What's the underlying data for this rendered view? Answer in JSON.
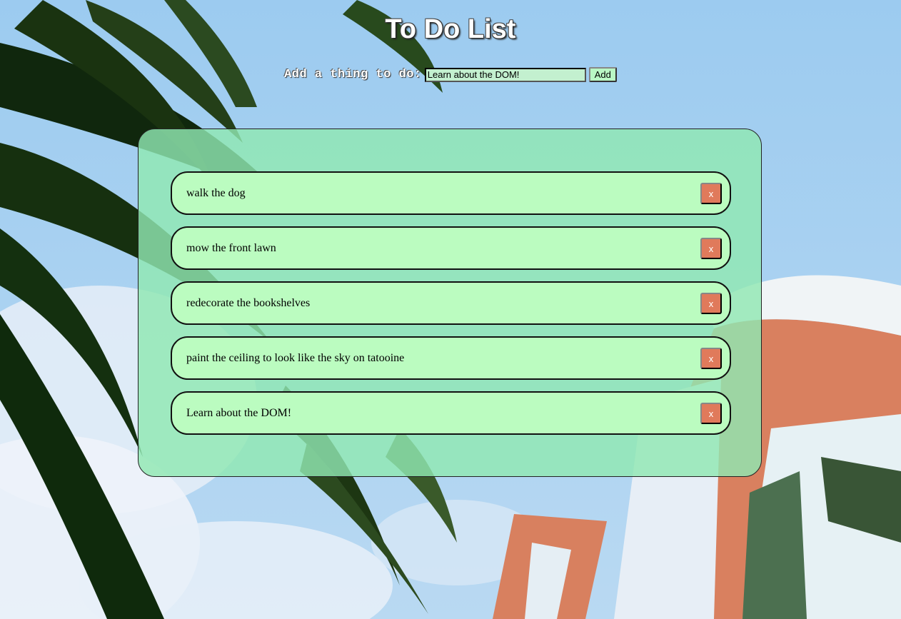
{
  "page": {
    "title": "To Do List"
  },
  "add_form": {
    "label": "Add a thing to do:",
    "input_value": "Learn about the DOM!",
    "button_label": "Add"
  },
  "todos": [
    {
      "text": "walk the dog",
      "delete_label": "x"
    },
    {
      "text": "mow the front lawn",
      "delete_label": "x"
    },
    {
      "text": "redecorate the bookshelves",
      "delete_label": "x"
    },
    {
      "text": "paint the ceiling to look like the sky on tatooine",
      "delete_label": "x"
    },
    {
      "text": "Learn about the DOM!",
      "delete_label": "x"
    }
  ],
  "colors": {
    "sky": "#a3cdef",
    "panel": "#94e6b8",
    "item": "#bbfcc0",
    "delete_button": "#e07a5b",
    "building": "#d98463",
    "palm": "#10260d"
  },
  "background": {
    "icon": "palm-tree-and-building-photo"
  }
}
